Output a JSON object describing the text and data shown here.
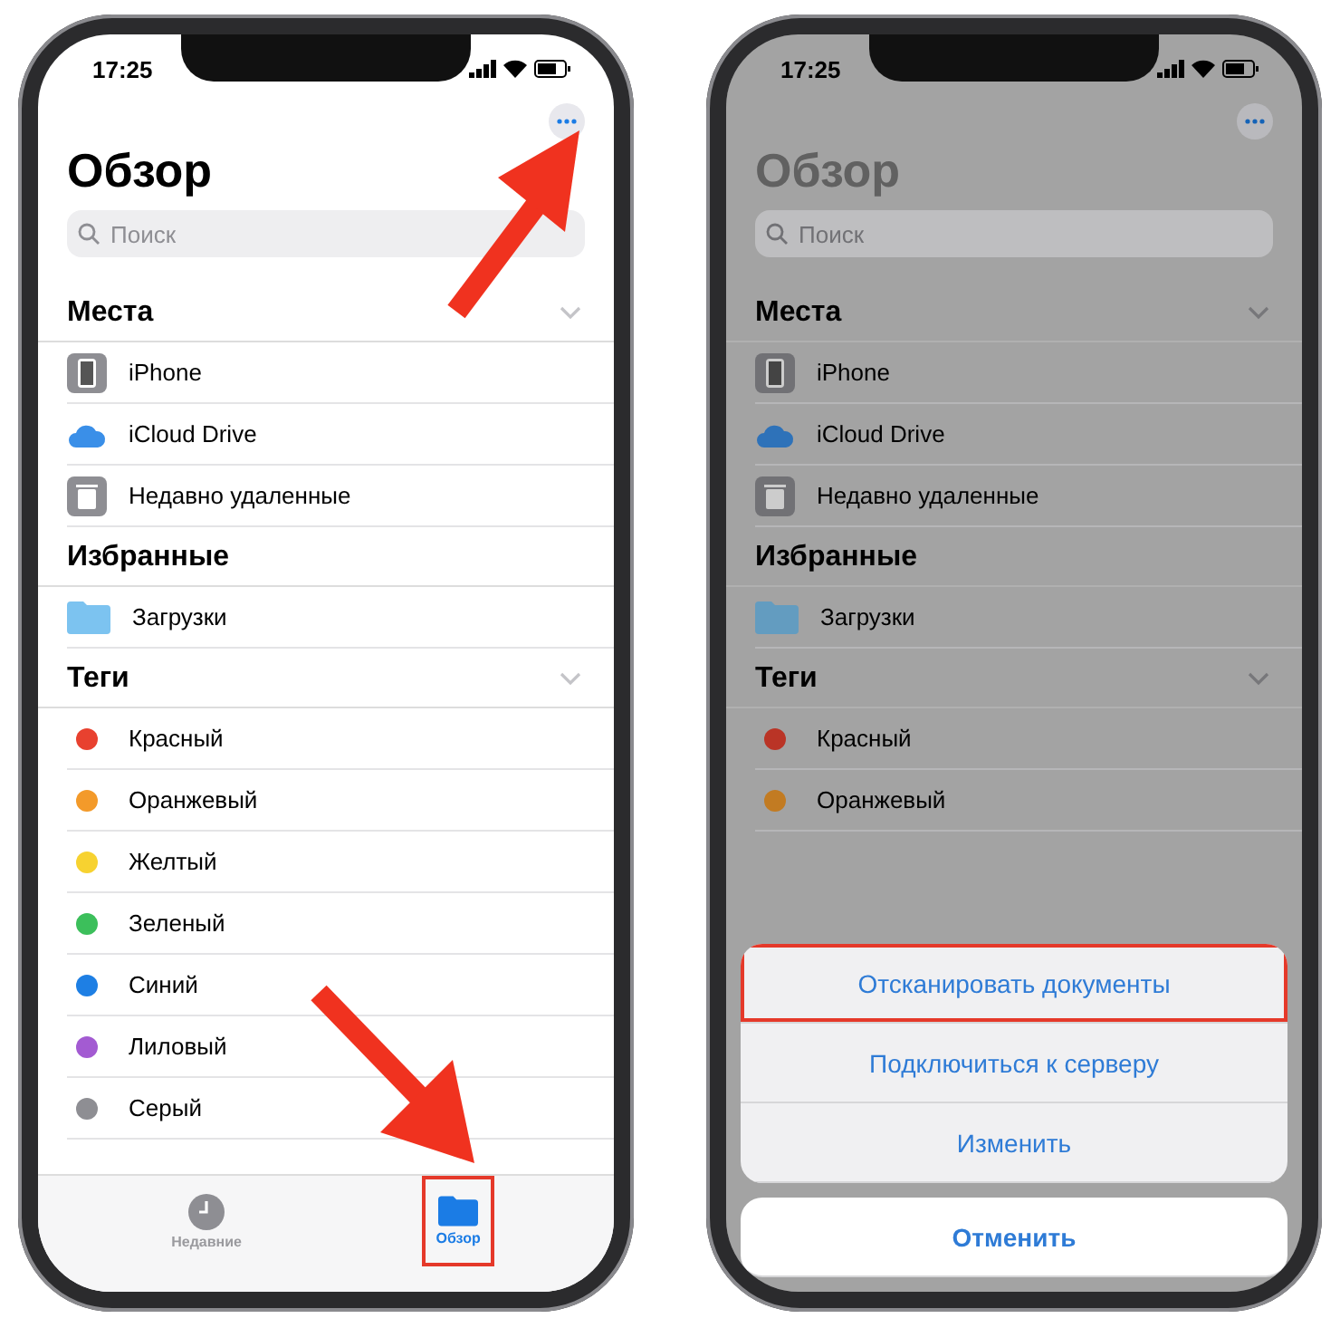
{
  "phones": [
    {
      "time": "17:25",
      "dimmed": false,
      "title": "Обзор",
      "search": {
        "placeholder": "Поиск"
      },
      "sections": [
        {
          "title": "Места",
          "expanded": true,
          "items": [
            {
              "kind": "device",
              "label": "iPhone"
            },
            {
              "kind": "cloud",
              "label": "iCloud Drive"
            },
            {
              "kind": "trash",
              "label": "Недавно удаленные"
            }
          ]
        },
        {
          "title": "Избранные",
          "items": [
            {
              "kind": "folder",
              "label": "Загрузки"
            }
          ]
        },
        {
          "title": "Теги",
          "expanded": true,
          "items": [
            {
              "kind": "tag",
              "label": "Красный",
              "color": "#e8412f"
            },
            {
              "kind": "tag",
              "label": "Оранжевый",
              "color": "#f39a2a"
            },
            {
              "kind": "tag",
              "label": "Желтый",
              "color": "#f7d230"
            },
            {
              "kind": "tag",
              "label": "Зеленый",
              "color": "#3cbf5b"
            },
            {
              "kind": "tag",
              "label": "Синий",
              "color": "#1e7fe4"
            },
            {
              "kind": "tag",
              "label": "Лиловый",
              "color": "#a35bd2"
            },
            {
              "kind": "tag",
              "label": "Серый",
              "color": "#8e8e93"
            }
          ]
        }
      ],
      "tab_bar": [
        {
          "label": "Недавние",
          "kind": "clock",
          "selected": false,
          "highlighted": false
        },
        {
          "label": "Обзор",
          "kind": "folder",
          "selected": true,
          "highlighted": true
        }
      ]
    },
    {
      "time": "17:25",
      "dimmed": true,
      "title": "Обзор",
      "search": {
        "placeholder": "Поиск"
      },
      "sections": [
        {
          "title": "Места",
          "expanded": true,
          "items": [
            {
              "kind": "device",
              "label": "iPhone"
            },
            {
              "kind": "cloud",
              "label": "iCloud Drive"
            },
            {
              "kind": "trash",
              "label": "Недавно удаленные"
            }
          ]
        },
        {
          "title": "Избранные",
          "items": [
            {
              "kind": "folder",
              "label": "Загрузки"
            }
          ]
        },
        {
          "title": "Теги",
          "expanded": true,
          "items": [
            {
              "kind": "tag",
              "label": "Красный",
              "color": "#ba3426"
            },
            {
              "kind": "tag",
              "label": "Оранжевый",
              "color": "#c27b22"
            }
          ]
        }
      ],
      "action_sheet": {
        "actions": [
          {
            "label": "Отсканировать документы",
            "highlighted": true
          },
          {
            "label": "Подключиться к серверу",
            "highlighted": false
          },
          {
            "label": "Изменить",
            "highlighted": false
          }
        ],
        "cancel": "Отменить"
      }
    }
  ]
}
